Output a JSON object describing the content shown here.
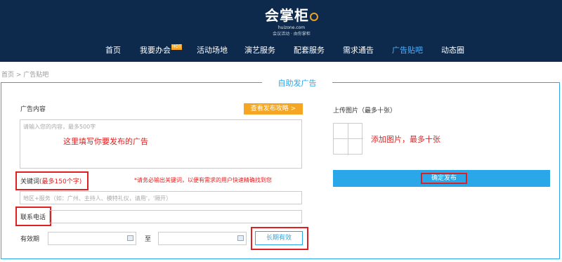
{
  "header": {
    "logo_main": "会掌柜",
    "logo_domain": "huizone.com",
    "logo_slogan": "会议活动 · 由你掌柜",
    "hot_badge": "HOT",
    "nav": [
      {
        "label": "首页",
        "active": false
      },
      {
        "label": "我要办会",
        "active": false
      },
      {
        "label": "活动场地",
        "active": false
      },
      {
        "label": "演艺服务",
        "active": false
      },
      {
        "label": "配套服务",
        "active": false
      },
      {
        "label": "需求通告",
        "active": false
      },
      {
        "label": "广告贴吧",
        "active": true
      },
      {
        "label": "动态圈",
        "active": false
      }
    ]
  },
  "breadcrumb": "首页 > 广告贴吧",
  "panel": {
    "title": "自助发广告",
    "content_label": "广告内容",
    "guide_button": "查看发布攻略 >",
    "content_placeholder": "请输入您的内容，最多500字",
    "content_annotation": "这里填写你要发布的广告",
    "keyword_label_prefix": "关键词",
    "keyword_label_limit": "(最多150个字)",
    "keyword_note": "*请务必输出关键词，以便有需求的用户快速精确找到您",
    "keyword_placeholder": "地区+服务（如：广州、主持人、模特礼仪，请用'，'隔开）",
    "phone_label": "联系电话",
    "validity_label": "有效期",
    "to_label": "至",
    "long_term_button": "长期有效",
    "upload_label": "上传图片（最多十张）",
    "upload_annotation": "添加图片，最多十张",
    "submit_button": "确定发布"
  },
  "colors": {
    "nav_bg": "#0d2a4d",
    "accent_blue": "#2aa7e8",
    "accent_orange": "#f5a623",
    "highlight_red": "#e02020"
  }
}
